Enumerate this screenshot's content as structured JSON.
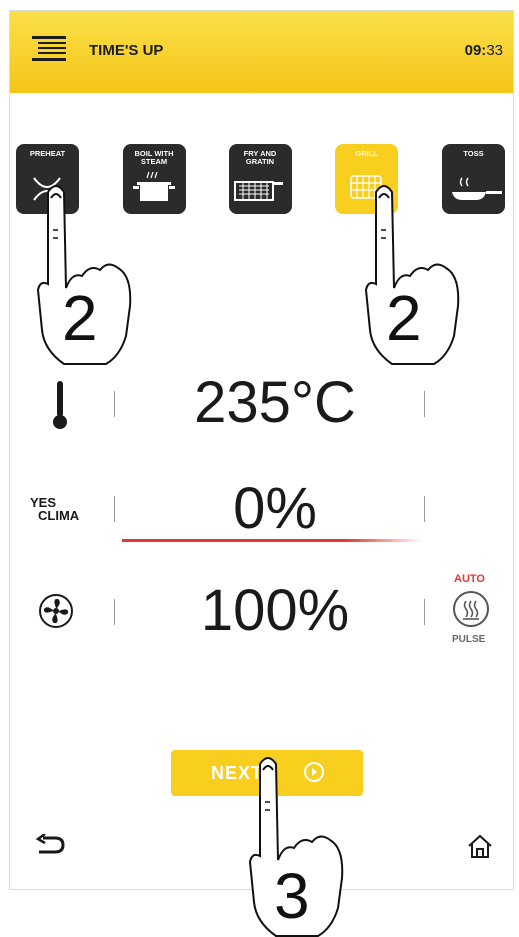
{
  "header": {
    "title": "TIME'S UP",
    "clock_hours": "09:",
    "clock_minutes": "33"
  },
  "modes": [
    {
      "label": "PREHEAT",
      "icon": "preheat-icon",
      "active": false
    },
    {
      "label": "BOIL WITH STEAM",
      "icon": "pot-steam-icon",
      "active": false
    },
    {
      "label": "FRY AND GRATIN",
      "icon": "fry-basket-icon",
      "active": false
    },
    {
      "label": "GRILL",
      "icon": "grill-icon",
      "active": true
    },
    {
      "label": "TOSS",
      "icon": "pan-toss-icon",
      "active": false
    }
  ],
  "temperature": {
    "value": "235°C",
    "icon": "thermometer-icon"
  },
  "humidity": {
    "value": "0%",
    "icon_text_top": "YES",
    "icon_text_bottom": "CLIMA"
  },
  "fan": {
    "value": "100%",
    "icon": "fan-icon",
    "mode_top": "AUTO",
    "mode_bottom": "PULSE"
  },
  "next_button": {
    "label": "NEXT"
  },
  "annotations": [
    {
      "label": "2",
      "target": "PREHEAT"
    },
    {
      "label": "2",
      "target": "GRILL"
    },
    {
      "label": "3",
      "target": "NEXT"
    }
  ],
  "colors": {
    "accent": "#F9CF1F",
    "mode_tile": "#2B2B2B",
    "red_indicator": "#E53935"
  }
}
